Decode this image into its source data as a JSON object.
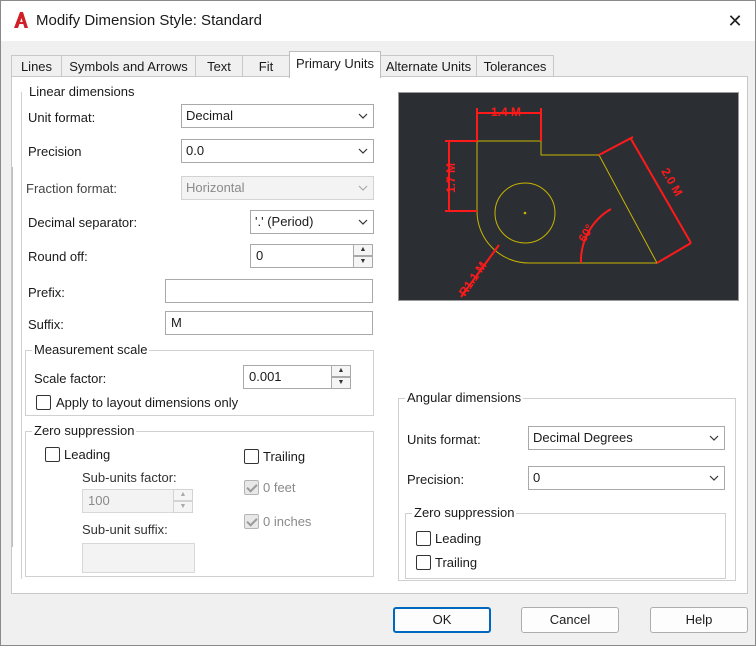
{
  "window": {
    "title": "Modify Dimension Style: Standard",
    "close_glyph": "✕"
  },
  "tabs": [
    "Lines",
    "Symbols and Arrows",
    "Text",
    "Fit",
    "Primary Units",
    "Alternate Units",
    "Tolerances"
  ],
  "active_tab": "Primary Units",
  "linear": {
    "title": "Linear dimensions",
    "unit_format_label": "Unit format:",
    "unit_format_value": "Decimal",
    "precision_label": "Precision",
    "precision_value": "0.0",
    "fraction_format_label": "Fraction format:",
    "fraction_format_value": "Horizontal",
    "decimal_separator_label": "Decimal separator:",
    "decimal_separator_value": "'.' (Period)",
    "round_off_label": "Round off:",
    "round_off_value": "0",
    "prefix_label": "Prefix:",
    "prefix_value": "",
    "suffix_label": "Suffix:",
    "suffix_value": "M"
  },
  "measurement": {
    "title": "Measurement scale",
    "scale_factor_label": "Scale factor:",
    "scale_factor_value": "0.001",
    "apply_layout_label": "Apply to layout dimensions only"
  },
  "zero_linear": {
    "title": "Zero suppression",
    "leading_label": "Leading",
    "trailing_label": "Trailing",
    "subunits_factor_label": "Sub-units factor:",
    "subunits_factor_value": "100",
    "zero_feet_label": "0 feet",
    "zero_inches_label": "0 inches",
    "subunit_suffix_label": "Sub-unit suffix:"
  },
  "preview": {
    "dim_top": "1.4 M",
    "dim_left": "1.7 M",
    "dim_right": "2.0 M",
    "dim_angle": "60°",
    "dim_radius": "R1.1 M"
  },
  "angular": {
    "title": "Angular dimensions",
    "units_format_label": "Units format:",
    "units_format_value": "Decimal Degrees",
    "precision_label": "Precision:",
    "precision_value": "0",
    "zero_title": "Zero suppression",
    "leading_label": "Leading",
    "trailing_label": "Trailing"
  },
  "buttons": {
    "ok": "OK",
    "cancel": "Cancel",
    "help": "Help"
  },
  "colors": {
    "preview_bg": "#2b2f34",
    "dim_red": "#ff1a1a",
    "geometry_yellow": "#c8b400",
    "accent_blue": "#0067c0"
  }
}
